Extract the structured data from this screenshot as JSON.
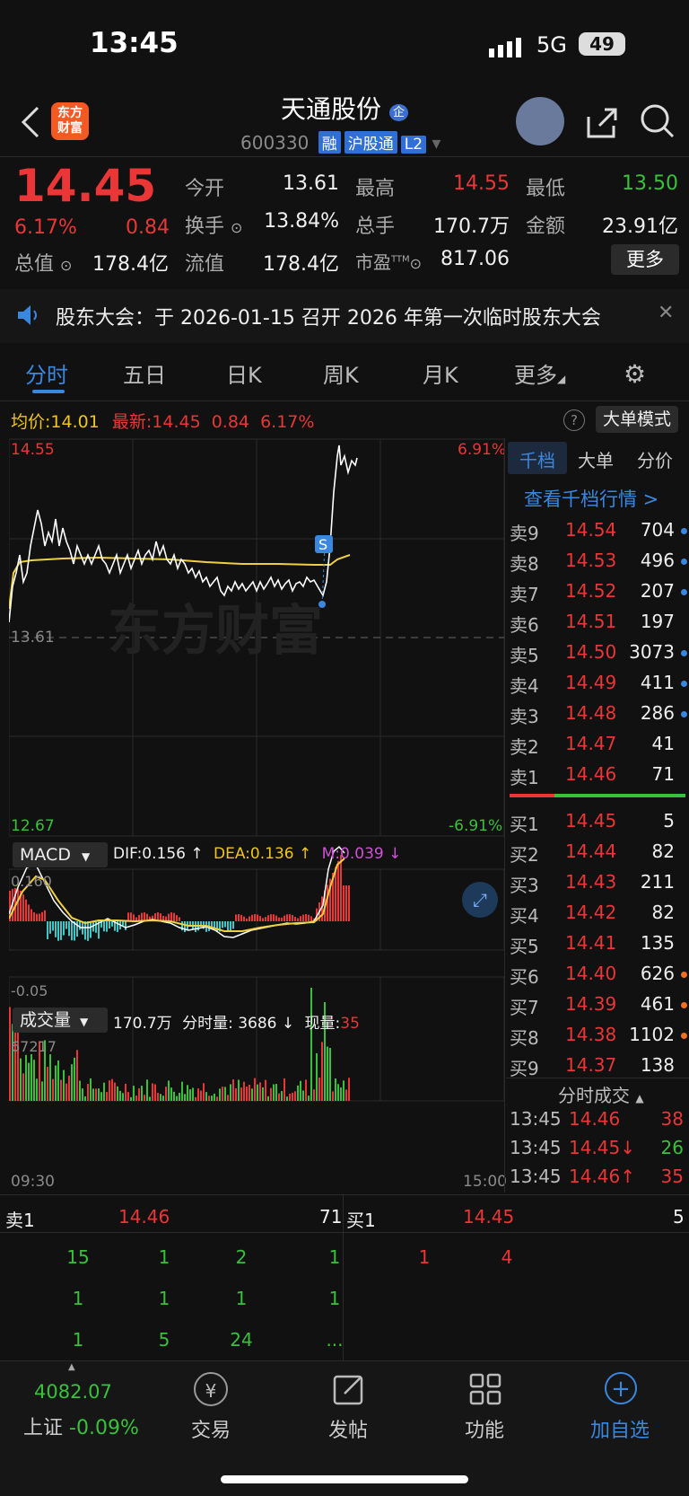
{
  "status_bar": {
    "time": "13:45",
    "network": "5G",
    "battery": "49"
  },
  "header": {
    "title": "天通股份",
    "title_badge": "企",
    "code": "600330",
    "tags": [
      "融",
      "沪股通",
      "L2"
    ],
    "logo_text": [
      "东方",
      "财富"
    ]
  },
  "quote": {
    "price": "14.45",
    "change_pct": "6.17%",
    "change": "0.84",
    "today_open_label": "今开",
    "today_open": "13.61",
    "high_label": "最高",
    "high": "14.55",
    "low_label": "最低",
    "low": "13.50",
    "turnover_label": "换手",
    "turnover": "13.84%",
    "total_hands_label": "总手",
    "total_hands": "170.7万",
    "amount_label": "金额",
    "amount": "23.91亿",
    "total_value_label": "总值",
    "total_value": "178.4亿",
    "float_value_label": "流值",
    "float_value": "178.4亿",
    "pe_label": "市盈",
    "pe_sup": "TTM",
    "pe": "817.06",
    "more": "更多"
  },
  "notice": {
    "text": "股东大会：于 2026-01-15 召开 2026 年第一次临时股东大会"
  },
  "tabs": [
    "分时",
    "五日",
    "日K",
    "周K",
    "月K",
    "更多"
  ],
  "chart": {
    "avg_label": "均价:",
    "avg_value": "14.01",
    "latest_label": "最新:",
    "latest_value": "14.45",
    "latest_change": "0.84",
    "latest_pct": "6.17%",
    "mode_button": "大单模式",
    "y_top": "14.55",
    "y_mid": "13.61",
    "y_bottom": "12.67",
    "pct_top": "6.91%",
    "pct_bottom": "-6.91%",
    "s_marker": "S",
    "watermark": "东方财富",
    "macd_label": "MACD",
    "dif": "DIF:0.156 ↑",
    "dea": "DEA:0.136 ↑",
    "m": "M:0.039 ↓",
    "macd_top": "0.160",
    "macd_bottom": "-0.05",
    "vol_label": "成交量",
    "vol_total": "170.7万",
    "vol_minute": "分时量: 3686 ↓",
    "vol_now_label": "现量:",
    "vol_now": "35",
    "vol_top": "67217",
    "time_start": "09:30",
    "time_end": "15:00"
  },
  "right_panel": {
    "tabs": [
      "千档",
      "大单",
      "分价"
    ],
    "view_more": "查看千档行情 >",
    "sell": [
      {
        "label": "卖9",
        "price": "14.54",
        "vol": "704",
        "dot": "blue"
      },
      {
        "label": "卖8",
        "price": "14.53",
        "vol": "496",
        "dot": "blue"
      },
      {
        "label": "卖7",
        "price": "14.52",
        "vol": "207",
        "dot": "blue"
      },
      {
        "label": "卖6",
        "price": "14.51",
        "vol": "197",
        "dot": ""
      },
      {
        "label": "卖5",
        "price": "14.50",
        "vol": "3073",
        "dot": "blue"
      },
      {
        "label": "卖4",
        "price": "14.49",
        "vol": "411",
        "dot": "blue"
      },
      {
        "label": "卖3",
        "price": "14.48",
        "vol": "286",
        "dot": "blue"
      },
      {
        "label": "卖2",
        "price": "14.47",
        "vol": "41",
        "dot": ""
      },
      {
        "label": "卖1",
        "price": "14.46",
        "vol": "71",
        "dot": ""
      }
    ],
    "buy": [
      {
        "label": "买1",
        "price": "14.45",
        "vol": "5",
        "dot": ""
      },
      {
        "label": "买2",
        "price": "14.44",
        "vol": "82",
        "dot": ""
      },
      {
        "label": "买3",
        "price": "14.43",
        "vol": "211",
        "dot": ""
      },
      {
        "label": "买4",
        "price": "14.42",
        "vol": "82",
        "dot": ""
      },
      {
        "label": "买5",
        "price": "14.41",
        "vol": "135",
        "dot": ""
      },
      {
        "label": "买6",
        "price": "14.40",
        "vol": "626",
        "dot": "orange"
      },
      {
        "label": "买7",
        "price": "14.39",
        "vol": "461",
        "dot": "orange"
      },
      {
        "label": "买8",
        "price": "14.38",
        "vol": "1102",
        "dot": "orange"
      },
      {
        "label": "买9",
        "price": "14.37",
        "vol": "138",
        "dot": ""
      }
    ],
    "trades_title": "分时成交",
    "trades": [
      {
        "time": "13:45",
        "price": "14.46",
        "vol": "38",
        "vol_color": "red"
      },
      {
        "time": "13:45",
        "price": "14.45↓",
        "vol": "26",
        "vol_color": "green"
      },
      {
        "time": "13:45",
        "price": "14.46↑",
        "vol": "35",
        "vol_color": "red"
      }
    ]
  },
  "queue": {
    "sell_label": "卖1",
    "sell_price": "14.46",
    "sell_vol": "71",
    "buy_label": "买1",
    "buy_price": "14.45",
    "buy_vol": "5",
    "sell_rows": [
      [
        "15",
        "1",
        "2",
        "1"
      ],
      [
        "1",
        "1",
        "1",
        "1"
      ],
      [
        "1",
        "5",
        "24",
        "..."
      ]
    ],
    "buy_rows": [
      [
        "1",
        "4"
      ]
    ]
  },
  "bottom_nav": {
    "index_value": "4082.07",
    "index_name": "上证",
    "index_pct": "-0.09%",
    "items": [
      "交易",
      "发帖",
      "功能",
      "加自选"
    ]
  },
  "colors": {
    "up": "#ea3636",
    "down": "#37c23a",
    "accent": "#3a87e0"
  }
}
